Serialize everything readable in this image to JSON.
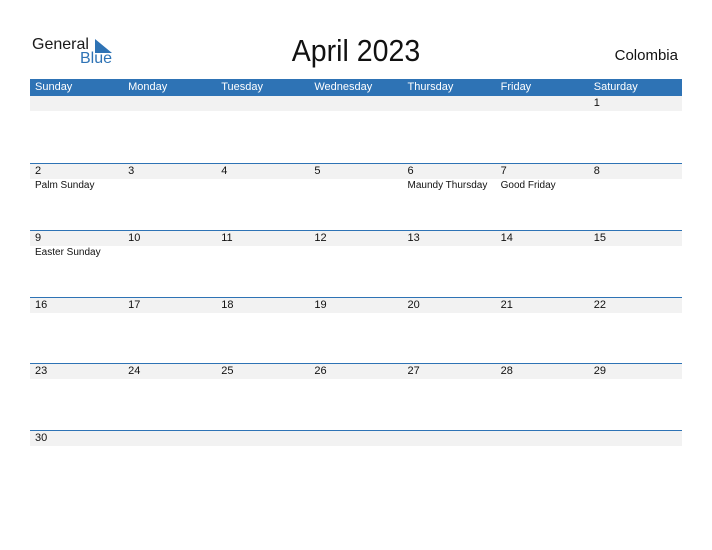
{
  "logo": {
    "general": "General",
    "blue": "Blue"
  },
  "title": "April 2023",
  "country": "Colombia",
  "weekdays": [
    "Sunday",
    "Monday",
    "Tuesday",
    "Wednesday",
    "Thursday",
    "Friday",
    "Saturday"
  ],
  "weeks": [
    [
      {
        "d": ""
      },
      {
        "d": ""
      },
      {
        "d": ""
      },
      {
        "d": ""
      },
      {
        "d": ""
      },
      {
        "d": ""
      },
      {
        "d": "1"
      }
    ],
    [
      {
        "d": "2",
        "e": "Palm Sunday"
      },
      {
        "d": "3"
      },
      {
        "d": "4"
      },
      {
        "d": "5"
      },
      {
        "d": "6",
        "e": "Maundy Thursday"
      },
      {
        "d": "7",
        "e": "Good Friday"
      },
      {
        "d": "8"
      }
    ],
    [
      {
        "d": "9",
        "e": "Easter Sunday"
      },
      {
        "d": "10"
      },
      {
        "d": "11"
      },
      {
        "d": "12"
      },
      {
        "d": "13"
      },
      {
        "d": "14"
      },
      {
        "d": "15"
      }
    ],
    [
      {
        "d": "16"
      },
      {
        "d": "17"
      },
      {
        "d": "18"
      },
      {
        "d": "19"
      },
      {
        "d": "20"
      },
      {
        "d": "21"
      },
      {
        "d": "22"
      }
    ],
    [
      {
        "d": "23"
      },
      {
        "d": "24"
      },
      {
        "d": "25"
      },
      {
        "d": "26"
      },
      {
        "d": "27"
      },
      {
        "d": "28"
      },
      {
        "d": "29"
      }
    ],
    [
      {
        "d": "30"
      },
      {
        "d": ""
      },
      {
        "d": ""
      },
      {
        "d": ""
      },
      {
        "d": ""
      },
      {
        "d": ""
      },
      {
        "d": ""
      }
    ]
  ]
}
